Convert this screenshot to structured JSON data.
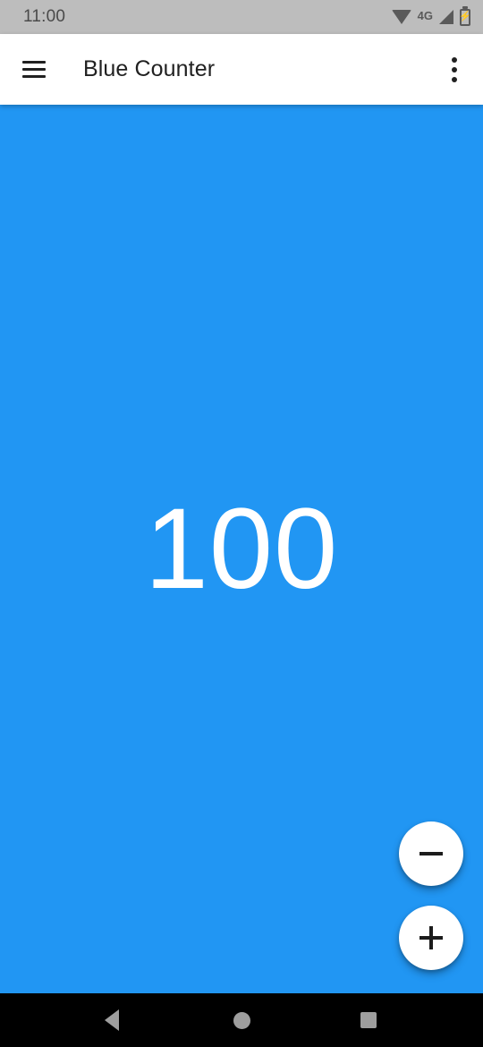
{
  "status_bar": {
    "clock": "11:00",
    "network_label": "4G",
    "icons": {
      "wifi": "wifi-icon",
      "signal": "signal-icon",
      "battery": "battery-charging-icon",
      "battery_glyph": "⚡"
    },
    "background_color": "#bdbdbd"
  },
  "app_bar": {
    "title": "Blue Counter",
    "menu_icon": "hamburger-menu-icon",
    "overflow_icon": "overflow-menu-icon",
    "background_color": "#ffffff",
    "text_color": "#212121"
  },
  "main": {
    "counter_value": "100",
    "background_color": "#2196f3",
    "text_color": "#ffffff"
  },
  "actions": {
    "decrement": {
      "label": "−",
      "name": "decrement-fab",
      "background_color": "#ffffff"
    },
    "increment": {
      "label": "+",
      "name": "increment-fab",
      "background_color": "#ffffff"
    }
  },
  "nav_bar": {
    "back_label": "Back",
    "home_label": "Home",
    "recents_label": "Recent apps",
    "background_color": "#000000",
    "glyph_color": "#9e9e9e"
  }
}
